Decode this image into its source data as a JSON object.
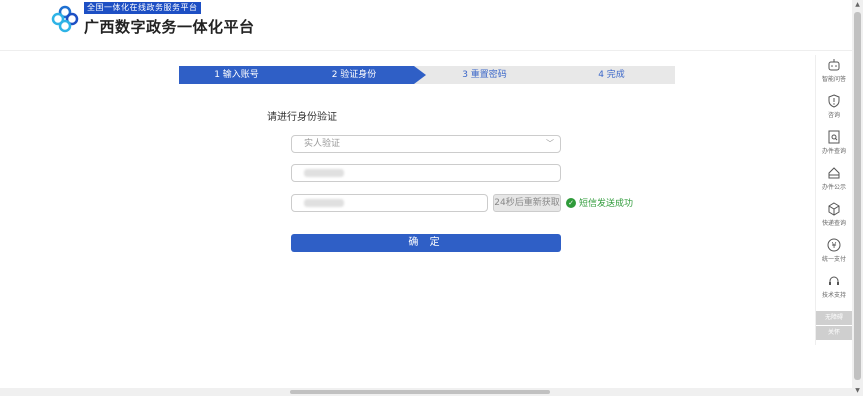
{
  "header": {
    "brand_small": "全国一体化在线政务服务平台",
    "brand_big": "广西数字政务一体化平台"
  },
  "steps": [
    {
      "label": "1 输入账号",
      "state": "done"
    },
    {
      "label": "2 验证身份",
      "state": "active"
    },
    {
      "label": "3 重置密码",
      "state": "todo"
    },
    {
      "label": "4 完成",
      "state": "todo"
    }
  ],
  "form": {
    "title": "请进行身份验证",
    "method_select": "实人验证",
    "resend_label": "24秒后重新获取",
    "success_text": "短信发送成功",
    "submit_label": "确 定"
  },
  "rightbar": {
    "items": [
      {
        "label": "智能问答",
        "icon": "robot-icon"
      },
      {
        "label": "咨询",
        "icon": "shield-alert-icon"
      },
      {
        "label": "办件查询",
        "icon": "document-search-icon"
      },
      {
        "label": "办件公示",
        "icon": "home-icon"
      },
      {
        "label": "快递查询",
        "icon": "package-icon"
      },
      {
        "label": "统一支付",
        "icon": "yuan-icon"
      },
      {
        "label": "技术支持",
        "icon": "headset-icon"
      }
    ],
    "bottom": [
      "无障碍",
      "关怀"
    ]
  },
  "colors": {
    "primary": "#2f5fc6",
    "success": "#2f9b3a"
  }
}
